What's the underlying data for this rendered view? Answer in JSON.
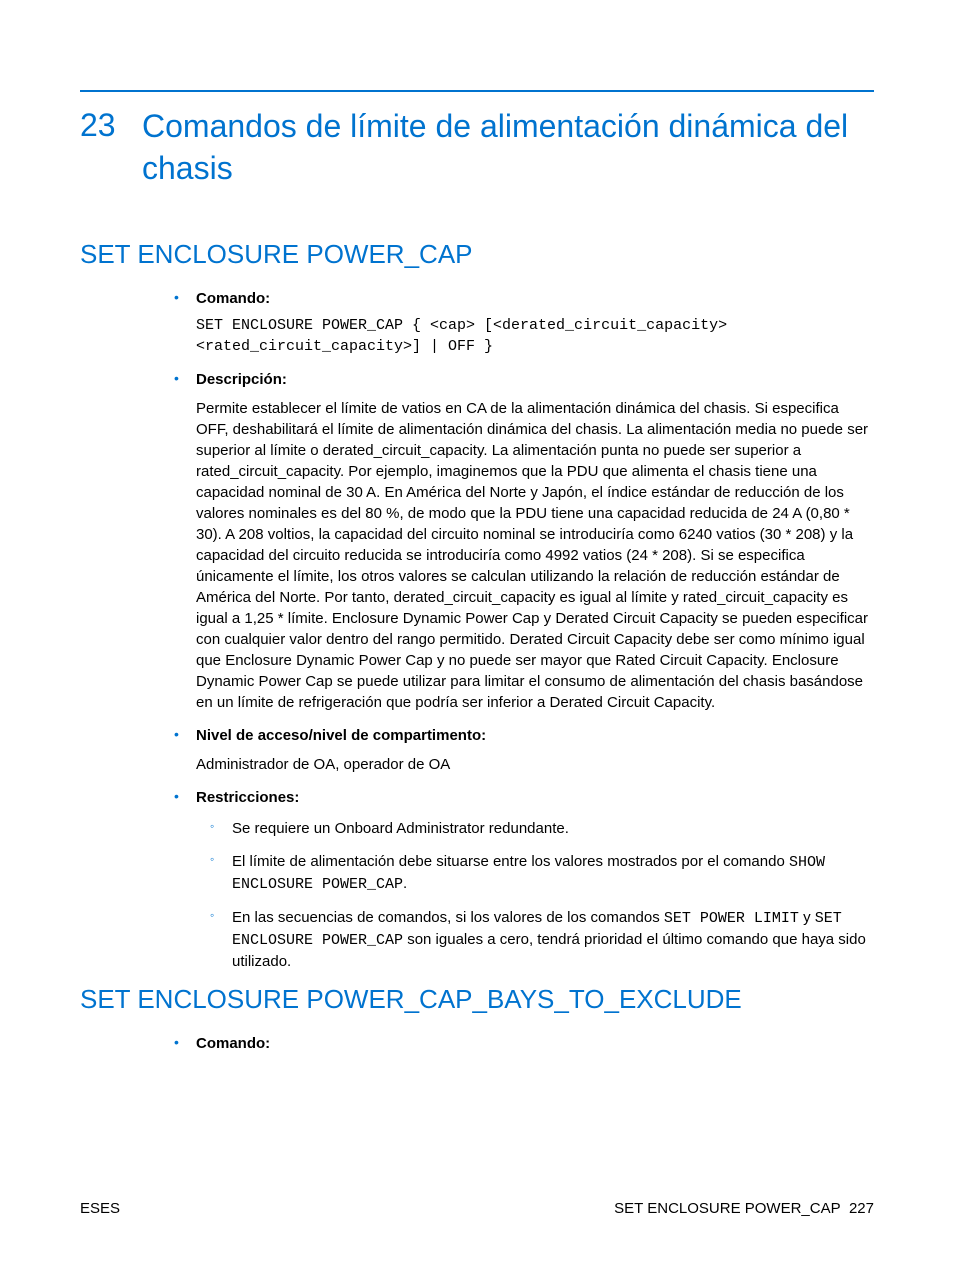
{
  "chapter": {
    "number": "23",
    "title": "Comandos de límite de alimentación dinámica del chasis"
  },
  "sections": [
    {
      "title": "SET ENCLOSURE POWER_CAP",
      "items": [
        {
          "label": "Comando:",
          "code": "SET ENCLOSURE POWER_CAP { <cap> [<derated_circuit_capacity> <rated_circuit_capacity>] | OFF }"
        },
        {
          "label": "Descripción:",
          "text": "Permite establecer el límite de vatios en CA de la alimentación dinámica del chasis. Si especifica OFF, deshabilitará el límite de alimentación dinámica del chasis. La alimentación media no puede ser superior al límite o derated_circuit_capacity. La alimentación punta no puede ser superior a rated_circuit_capacity. Por ejemplo, imaginemos que la PDU que alimenta el chasis tiene una capacidad nominal de 30 A. En América del Norte y Japón, el índice estándar de reducción de los valores nominales es del 80 %, de modo que la PDU tiene una capacidad reducida de 24 A (0,80 * 30). A 208 voltios, la capacidad del circuito nominal se introduciría como 6240 vatios (30 * 208) y la capacidad del circuito reducida se introduciría como 4992 vatios (24 * 208). Si se especifica únicamente el límite, los otros valores se calculan utilizando la relación de reducción estándar de América del Norte. Por tanto, derated_circuit_capacity es igual al límite y rated_circuit_capacity es igual a 1,25 * límite. Enclosure Dynamic Power Cap y Derated Circuit Capacity se pueden especificar con cualquier valor dentro del rango permitido. Derated Circuit Capacity debe ser como mínimo igual que Enclosure Dynamic Power Cap y no puede ser mayor que Rated Circuit Capacity. Enclosure Dynamic Power Cap se puede utilizar para limitar el consumo de alimentación del chasis basándose en un límite de refrigeración que podría ser inferior a Derated Circuit Capacity."
        },
        {
          "label": "Nivel de acceso/nivel de compartimento:",
          "text": "Administrador de OA, operador de OA"
        },
        {
          "label": "Restricciones:",
          "sub": [
            {
              "pre": "Se requiere un Onboard Administrator redundante."
            },
            {
              "pre": "El límite de alimentación debe situarse entre los valores mostrados por el comando ",
              "code": "SHOW ENCLOSURE POWER_CAP",
              "post": "."
            },
            {
              "pre": "En las secuencias de comandos, si los valores de los comandos ",
              "code": "SET POWER LIMIT",
              "mid": " y ",
              "code2": "SET ENCLOSURE POWER_CAP",
              "post": " son iguales a cero, tendrá prioridad el último comando que haya sido utilizado."
            }
          ]
        }
      ]
    },
    {
      "title": "SET ENCLOSURE POWER_CAP_BAYS_TO_EXCLUDE",
      "items": [
        {
          "label": "Comando:"
        }
      ]
    }
  ],
  "footer": {
    "left": "ESES",
    "right_label": "SET ENCLOSURE POWER_CAP",
    "page": "227"
  }
}
